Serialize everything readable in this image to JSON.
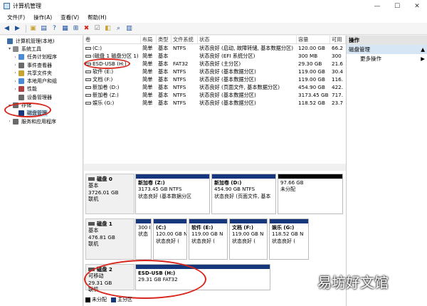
{
  "window": {
    "title": "计算机管理"
  },
  "menu": [
    {
      "label": "文件(F)"
    },
    {
      "label": "操作(A)"
    },
    {
      "label": "查看(V)"
    },
    {
      "label": "帮助(H)"
    }
  ],
  "tree": [
    {
      "label": "计算机管理(本地)",
      "icon": "computer-icon",
      "indent": 0,
      "caret": ""
    },
    {
      "label": "系统工具",
      "icon": "tools-icon",
      "indent": 1,
      "caret": "▾"
    },
    {
      "label": "任务计划程序",
      "icon": "clock-icon",
      "indent": 2,
      "caret": "›"
    },
    {
      "label": "事件查看器",
      "icon": "event-log-icon",
      "indent": 2,
      "caret": "›"
    },
    {
      "label": "共享文件夹",
      "icon": "folder-icon",
      "indent": 2,
      "caret": "›"
    },
    {
      "label": "本地用户和组",
      "icon": "users-icon",
      "indent": 2,
      "caret": "›"
    },
    {
      "label": "性能",
      "icon": "performance-icon",
      "indent": 2,
      "caret": "›"
    },
    {
      "label": "设备管理器",
      "icon": "device-manager-icon",
      "indent": 2,
      "caret": ""
    },
    {
      "label": "存储",
      "icon": "storage-icon",
      "indent": 1,
      "caret": "▾"
    },
    {
      "label": "磁盘管理",
      "icon": "disk-management-icon",
      "indent": 2,
      "caret": "",
      "selected": true
    },
    {
      "label": "服务和应用程序",
      "icon": "services-icon",
      "indent": 1,
      "caret": "›"
    }
  ],
  "volumes": {
    "columns": [
      "卷",
      "布局",
      "类型",
      "文件系统",
      "状态",
      "容量",
      "可用"
    ],
    "rows": [
      [
        "(C:)",
        "简单",
        "基本",
        "NTFS",
        "状态良好 (启动, 故障转储, 基本数据分区)",
        "120.00 GB",
        "66.2"
      ],
      [
        "(磁盘 1 磁盘分区 1)",
        "简单",
        "基本",
        "",
        "状态良好 (EFI 系统分区)",
        "300 MB",
        "300"
      ],
      [
        "ESD-USB (H:)",
        "简单",
        "基本",
        "FAT32",
        "状态良好 (主分区)",
        "29.30 GB",
        "21.6"
      ],
      [
        "软件 (E:)",
        "简单",
        "基本",
        "NTFS",
        "状态良好 (基本数据分区)",
        "119.00 GB",
        "30.4"
      ],
      [
        "文档 (F:)",
        "简单",
        "基本",
        "NTFS",
        "状态良好 (基本数据分区)",
        "119.00 GB",
        "116."
      ],
      [
        "新加卷 (D:)",
        "简单",
        "基本",
        "NTFS",
        "状态良好 (页面文件, 基本数据分区)",
        "454.90 GB",
        "422."
      ],
      [
        "新加卷 (Z:)",
        "简单",
        "基本",
        "NTFS",
        "状态良好 (基本数据分区)",
        "3173.45 GB",
        "717."
      ],
      [
        "娱乐 (G:)",
        "简单",
        "基本",
        "NTFS",
        "状态良好 (基本数据分区)",
        "118.52 GB",
        "23.7"
      ]
    ]
  },
  "actions": {
    "header": "操作",
    "group": "磁盘管理",
    "more": "更多操作"
  },
  "disks": [
    {
      "name": "磁盘 0",
      "type": "基本",
      "size": "3726.01 GB",
      "status": "联机",
      "partitions": [
        {
          "title": "新加卷 (Z:)",
          "size": "3173.45 GB NTFS",
          "status": "状态良好 (基本数据分区",
          "kind": "primary"
        },
        {
          "title": "新加卷 (D:)",
          "size": "454.90 GB NTFS",
          "status": "状态良好 (页面文件, 基本",
          "kind": "primary"
        },
        {
          "title": "",
          "size": "97.66 GB",
          "status": "未分配",
          "kind": "unalloc"
        }
      ]
    },
    {
      "name": "磁盘 1",
      "type": "基本",
      "size": "476.81 GB",
      "status": "联机",
      "partitions": [
        {
          "title": "",
          "size": "300 I",
          "status": "状态",
          "kind": "primary"
        },
        {
          "title": "(C:)",
          "size": "120.00 GB N",
          "status": "状态良好 (",
          "kind": "primary"
        },
        {
          "title": "软件 (E:)",
          "size": "119.00 GB N",
          "status": "状态良好 (",
          "kind": "primary"
        },
        {
          "title": "文档 (F:)",
          "size": "119.00 GB N",
          "status": "状态良好 (",
          "kind": "primary"
        },
        {
          "title": "娱乐 (G:)",
          "size": "118.52 GB N",
          "status": "状态良好 (",
          "kind": "primary"
        }
      ]
    },
    {
      "name": "磁盘 2",
      "type": "可移动",
      "size": "29.31 GB",
      "status": "联机",
      "partitions": [
        {
          "title": "ESD-USB (H:)",
          "size": "29.31 GB FAT32",
          "status": "",
          "kind": "primary"
        }
      ]
    }
  ],
  "legend": [
    {
      "label": "未分配",
      "color": "#000000"
    },
    {
      "label": "主分区",
      "color": "#17377d"
    }
  ],
  "watermark": "易坊好文馆"
}
